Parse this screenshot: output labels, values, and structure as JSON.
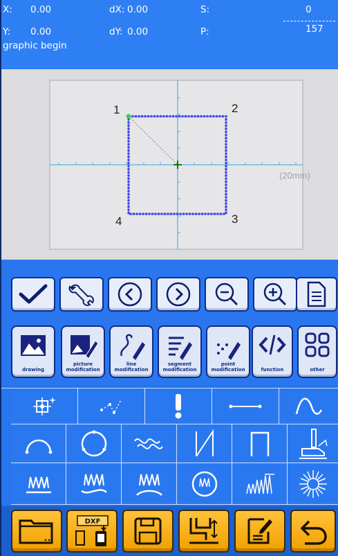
{
  "status": {
    "x_label": "X:",
    "x_value": "0.00",
    "dx_label": "dX:",
    "dx_value": "0.00",
    "s_label": "S:",
    "s_value": "0",
    "y_label": "Y:",
    "y_value": "0.00",
    "dy_label": "dY:",
    "dy_value": "0.00",
    "p_label": "P:",
    "p_value": "157",
    "message": "graphic begin"
  },
  "canvas": {
    "corner_labels": [
      "1",
      "2",
      "3",
      "4"
    ],
    "scale_label": "(20mm)",
    "colors": {
      "shape": "#2a2fd6",
      "axis": "#54b4e6",
      "start_point": "#3bd34a",
      "origin": "#0b7b0b"
    }
  },
  "toolbar": {
    "icons": [
      "confirm-check-icon",
      "settings-wrench-icon",
      "previous-icon",
      "next-icon",
      "zoom-out-icon",
      "zoom-in-icon",
      "document-icon"
    ]
  },
  "functions": [
    {
      "label": "drawing",
      "icon": "drawing-icon"
    },
    {
      "label": "picture modification",
      "icon": "picture-modification-icon"
    },
    {
      "label": "line modification",
      "icon": "line-modification-icon"
    },
    {
      "label": "segment modification",
      "icon": "segment-modification-icon"
    },
    {
      "label": "point modification",
      "icon": "point-modification-icon"
    },
    {
      "label": "function",
      "icon": "function-code-icon"
    },
    {
      "label": "other",
      "icon": "other-grid-icon"
    }
  ],
  "bottom_bar": {
    "dxf_label": "DXF",
    "icons": [
      "folder-icon",
      "dxf-import-icon",
      "save-icon",
      "sewing-machine-icon",
      "edit-note-icon",
      "back-arrow-icon"
    ]
  }
}
